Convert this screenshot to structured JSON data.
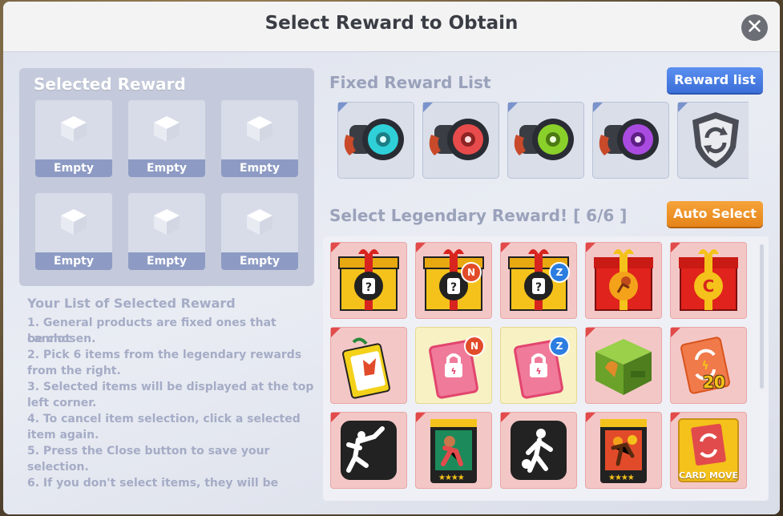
{
  "dialog": {
    "title": "Select Reward to Obtain",
    "close_icon": "close-icon"
  },
  "selected_reward": {
    "title": "Selected Reward",
    "slots": [
      {
        "label": "Empty"
      },
      {
        "label": "Empty"
      },
      {
        "label": "Empty"
      },
      {
        "label": "Empty"
      },
      {
        "label": "Empty"
      },
      {
        "label": "Empty"
      }
    ]
  },
  "instructions": {
    "heading": "Your List of Selected Reward",
    "lines": [
      "1. General products are fixed ones that cannot",
      "be chosen.",
      "2. Pick 6 items from the legendary rewards",
      "from the right.",
      "3. Selected items will be displayed at the top",
      "left corner.",
      "4. To cancel item selection, click a selected",
      "item again.",
      "5. Press the Close button to save your",
      "selection.",
      "6. If you don't select items, they will be"
    ]
  },
  "fixed_rewards": {
    "title": "Fixed Reward List",
    "button_label": "Reward list",
    "items": [
      {
        "icon": "cyan-rocket-ring-icon",
        "accent": "#2fd0d8"
      },
      {
        "icon": "red-rocket-ring-icon",
        "accent": "#e84b4b"
      },
      {
        "icon": "green-rocket-ring-icon",
        "accent": "#8ad02a"
      },
      {
        "icon": "purple-rocket-ring-icon",
        "accent": "#a94be0"
      },
      {
        "icon": "shield-refresh-icon",
        "accent": "#5a5d66"
      }
    ]
  },
  "legendary": {
    "title": "Select Legendary Reward! [ 6/6 ]",
    "button_label": "Auto Select",
    "badges": {
      "n": "N",
      "z": "Z",
      "count": "20",
      "stars": "★★★★"
    },
    "card_move_label": "CARD MOVE",
    "rows": [
      [
        {
          "icon": "gold-mystery-box-icon"
        },
        {
          "icon": "gold-mystery-box-n-icon"
        },
        {
          "icon": "gold-mystery-box-z-icon"
        },
        {
          "icon": "red-basketball-box-icon"
        },
        {
          "icon": "red-c-box-icon"
        }
      ],
      [
        {
          "icon": "jester-card-icon"
        },
        {
          "icon": "locked-card-n-icon"
        },
        {
          "icon": "locked-card-z-icon"
        },
        {
          "icon": "green-crate-icon"
        },
        {
          "icon": "card-refresh-20-icon"
        }
      ],
      [
        {
          "icon": "dunk-silhouette-icon"
        },
        {
          "icon": "player-card-4star-icon"
        },
        {
          "icon": "dribble-silhouette-icon"
        },
        {
          "icon": "fire-player-card-4star-icon"
        },
        {
          "icon": "card-move-icon"
        }
      ]
    ]
  },
  "colors": {
    "button_blue": "#3b6fd8",
    "button_orange": "#e5841a",
    "slot_label": "#8d9bc4",
    "legendary_cell": "#f4c7c7"
  }
}
